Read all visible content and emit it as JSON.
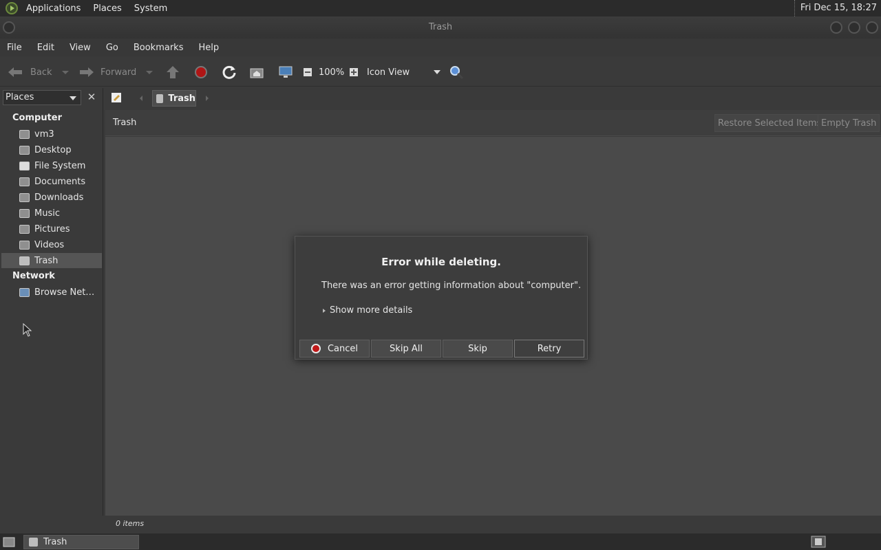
{
  "top_panel": {
    "menu": [
      "Applications",
      "Places",
      "System"
    ],
    "clock": "Fri Dec 15, 18:27"
  },
  "window": {
    "title": "Trash"
  },
  "menubar": [
    "File",
    "Edit",
    "View",
    "Go",
    "Bookmarks",
    "Help"
  ],
  "toolbar": {
    "back": "Back",
    "forward": "Forward",
    "zoom": "100%",
    "view_mode": "Icon View"
  },
  "sidebar": {
    "combo_label": "Places",
    "computer_header": "Computer",
    "items": [
      "vm3",
      "Desktop",
      "File System",
      "Documents",
      "Downloads",
      "Music",
      "Pictures",
      "Videos",
      "Trash"
    ],
    "network_header": "Network",
    "network_items": [
      "Browse Net…"
    ]
  },
  "location": {
    "crumb": "Trash"
  },
  "infobar": {
    "title": "Trash",
    "restore": "Restore Selected Items",
    "empty": "Empty Trash"
  },
  "status": {
    "items": "0 items"
  },
  "taskbar": {
    "task": "Trash"
  },
  "dialog": {
    "title": "Error while deleting.",
    "message": "There was an error getting information about \"computer\".",
    "details": "Show more details",
    "buttons": {
      "cancel": "Cancel",
      "skip_all": "Skip All",
      "skip": "Skip",
      "retry": "Retry"
    }
  },
  "colors": {
    "panel": "#2b2b2b",
    "window_bg": "#3a3a3a",
    "content_bg": "#4a4a4a",
    "stop_red": "#c01818"
  }
}
